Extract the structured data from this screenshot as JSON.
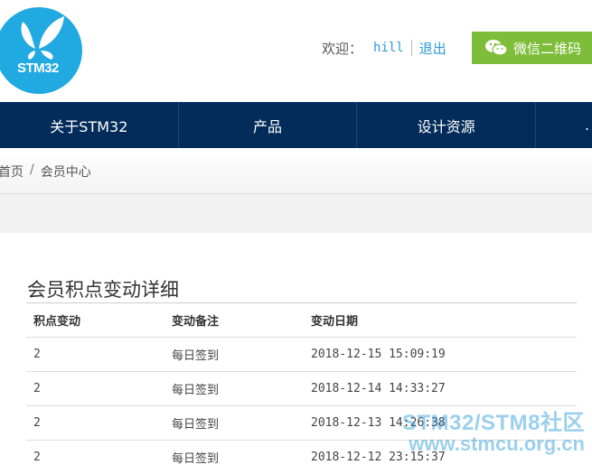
{
  "header": {
    "logo_text": "STM32",
    "welcome": "欢迎：",
    "username": "hill",
    "logout": "退出",
    "wechat_label": "微信二维码",
    "brand_color": "#21a9e1",
    "wechat_color": "#7dbd39"
  },
  "nav": {
    "items": [
      {
        "label": "关于STM32"
      },
      {
        "label": "产品"
      },
      {
        "label": "设计资源"
      },
      {
        "label": "."
      }
    ],
    "bg_color": "#032c5a"
  },
  "breadcrumb": {
    "home": "首页",
    "separator": "/",
    "current": "会员中心"
  },
  "main": {
    "title": "会员积点变动详细",
    "columns": [
      "积点变动",
      "变动备注",
      "变动日期"
    ],
    "rows": [
      {
        "points": "2",
        "note": "每日签到",
        "date": "2018-12-15 15:09:19"
      },
      {
        "points": "2",
        "note": "每日签到",
        "date": "2018-12-14 14:33:27"
      },
      {
        "points": "2",
        "note": "每日签到",
        "date": "2018-12-13 14:26:38"
      },
      {
        "points": "2",
        "note": "每日签到",
        "date": "2018-12-12 23:15:37"
      }
    ]
  },
  "watermark": {
    "line1": "STM32/STM8社区",
    "line2": "www.stmcu.org.cn"
  }
}
